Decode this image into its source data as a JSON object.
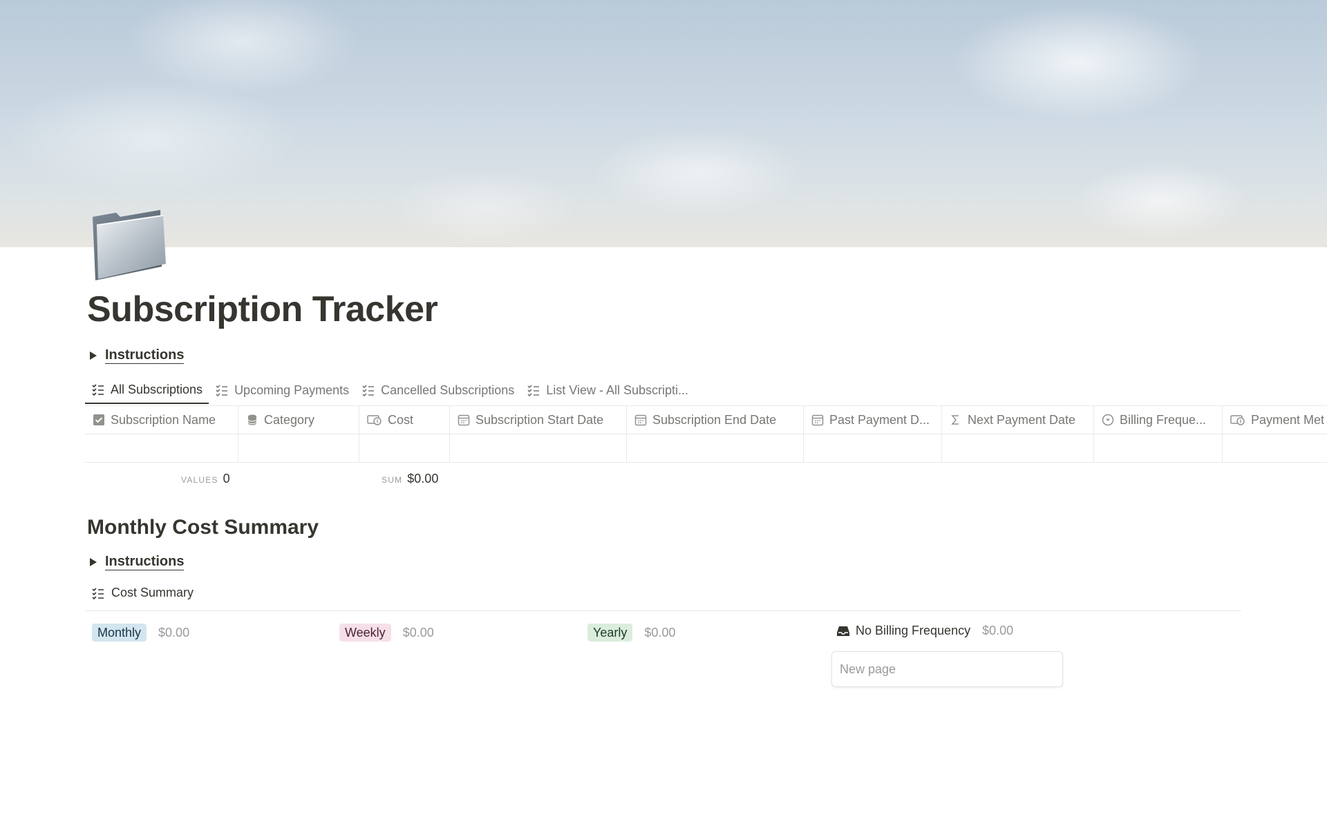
{
  "page": {
    "title": "Subscription Tracker",
    "icon": "file-folder-icon"
  },
  "instructions_toggle": {
    "label": "Instructions"
  },
  "views": [
    {
      "label": "All Subscriptions",
      "active": true
    },
    {
      "label": "Upcoming Payments",
      "active": false
    },
    {
      "label": "Cancelled Subscriptions",
      "active": false
    },
    {
      "label": "List View - All Subscripti...",
      "active": false
    }
  ],
  "table": {
    "columns": [
      {
        "label": "Subscription Name",
        "icon": "checkbox-icon"
      },
      {
        "label": "Category",
        "icon": "database-icon"
      },
      {
        "label": "Cost",
        "icon": "money-icon"
      },
      {
        "label": "Subscription Start Date",
        "icon": "calendar-icon"
      },
      {
        "label": "Subscription End Date",
        "icon": "calendar-icon"
      },
      {
        "label": "Past Payment D...",
        "icon": "calendar-icon"
      },
      {
        "label": "Next Payment Date",
        "icon": "sigma-icon"
      },
      {
        "label": "Billing Freque...",
        "icon": "status-icon"
      },
      {
        "label": "Payment Met",
        "icon": "money-icon"
      }
    ],
    "calculations": [
      {
        "key": "VALUES",
        "value": "0"
      },
      {
        "key": "SUM",
        "value": "$0.00"
      }
    ]
  },
  "summary": {
    "heading": "Monthly Cost Summary",
    "instructions_label": "Instructions",
    "view_label": "Cost Summary",
    "groups": [
      {
        "label": "Monthly",
        "amount": "$0.00",
        "color": "#d3e5ef"
      },
      {
        "label": "Weekly",
        "amount": "$0.00",
        "color": "#f5e0e9"
      },
      {
        "label": "Yearly",
        "amount": "$0.00",
        "color": "#dbeddb"
      },
      {
        "label": "No Billing Frequency",
        "amount": "$0.00",
        "icon": "inbox-icon"
      }
    ],
    "new_page_placeholder": "New page"
  }
}
